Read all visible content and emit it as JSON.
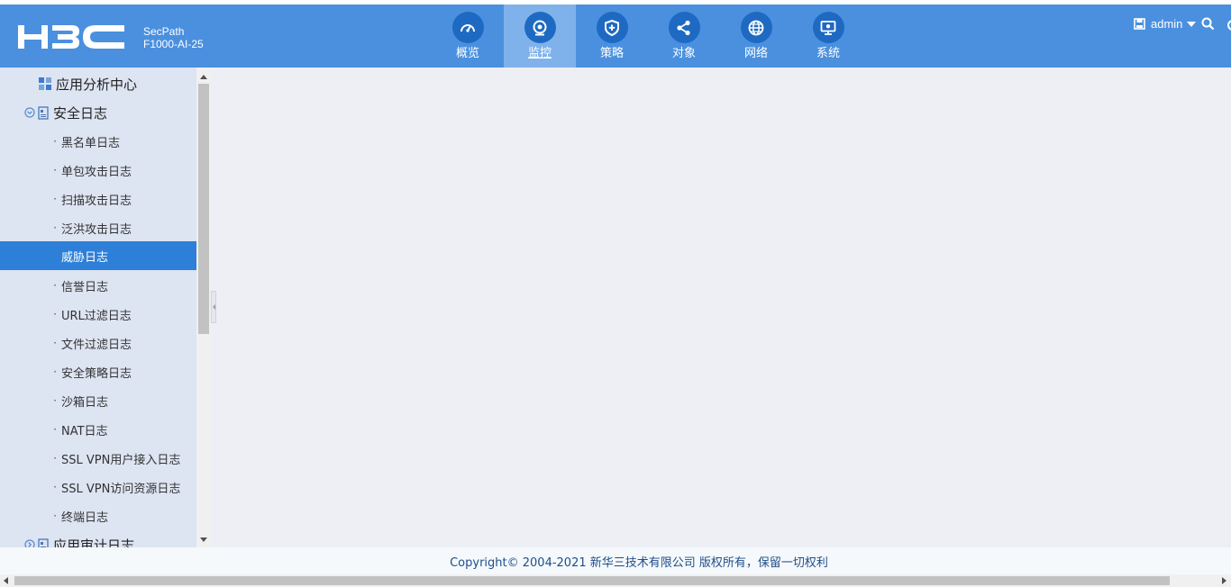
{
  "header": {
    "brand": "H3C",
    "product_line1": "SecPath",
    "product_line2": "F1000-AI-25",
    "nav": [
      {
        "label": "概览",
        "icon": "dashboard-gauge-icon",
        "active": false
      },
      {
        "label": "监控",
        "icon": "webcam-monitor-icon",
        "active": true
      },
      {
        "label": "策略",
        "icon": "shield-plus-icon",
        "active": false
      },
      {
        "label": "对象",
        "icon": "share-nodes-icon",
        "active": false
      },
      {
        "label": "网络",
        "icon": "globe-icon",
        "active": false
      },
      {
        "label": "系统",
        "icon": "computer-screen-icon",
        "active": false
      }
    ],
    "user": "admin"
  },
  "sidebar": {
    "items": [
      {
        "label": "应用分析中心",
        "level": 1,
        "icon": "grid-tiles-icon"
      },
      {
        "label": "安全日志",
        "level": 1,
        "icon": "document-log-icon",
        "expanded": true
      },
      {
        "label": "黑名单日志",
        "level": 2
      },
      {
        "label": "单包攻击日志",
        "level": 2
      },
      {
        "label": "扫描攻击日志",
        "level": 2
      },
      {
        "label": "泛洪攻击日志",
        "level": 2
      },
      {
        "label": "威胁日志",
        "level": 2,
        "active": true
      },
      {
        "label": "信誉日志",
        "level": 2
      },
      {
        "label": "URL过滤日志",
        "level": 2
      },
      {
        "label": "文件过滤日志",
        "level": 2
      },
      {
        "label": "安全策略日志",
        "level": 2
      },
      {
        "label": "沙箱日志",
        "level": 2
      },
      {
        "label": "NAT日志",
        "level": 2
      },
      {
        "label": "SSL VPN用户接入日志",
        "level": 2
      },
      {
        "label": "SSL VPN访问资源日志",
        "level": 2
      },
      {
        "label": "终端日志",
        "level": 2
      },
      {
        "label": "应用审计日志",
        "level": 1,
        "icon": "document-log-icon",
        "expanded": false
      }
    ],
    "dot_glyph": "·"
  },
  "footer": {
    "copyright": "Copyright© 2004-2021 新华三技术有限公司 版权所有，保留一切权利"
  },
  "colors": {
    "header_bg": "#4a90df",
    "nav_active_bg": "#7fb2ea",
    "nav_icon_bg": "#1e6ac2",
    "sidebar_bg": "#dde4f2",
    "sidebar_active_bg": "#2d7fd8",
    "content_bg": "#edeff5"
  }
}
